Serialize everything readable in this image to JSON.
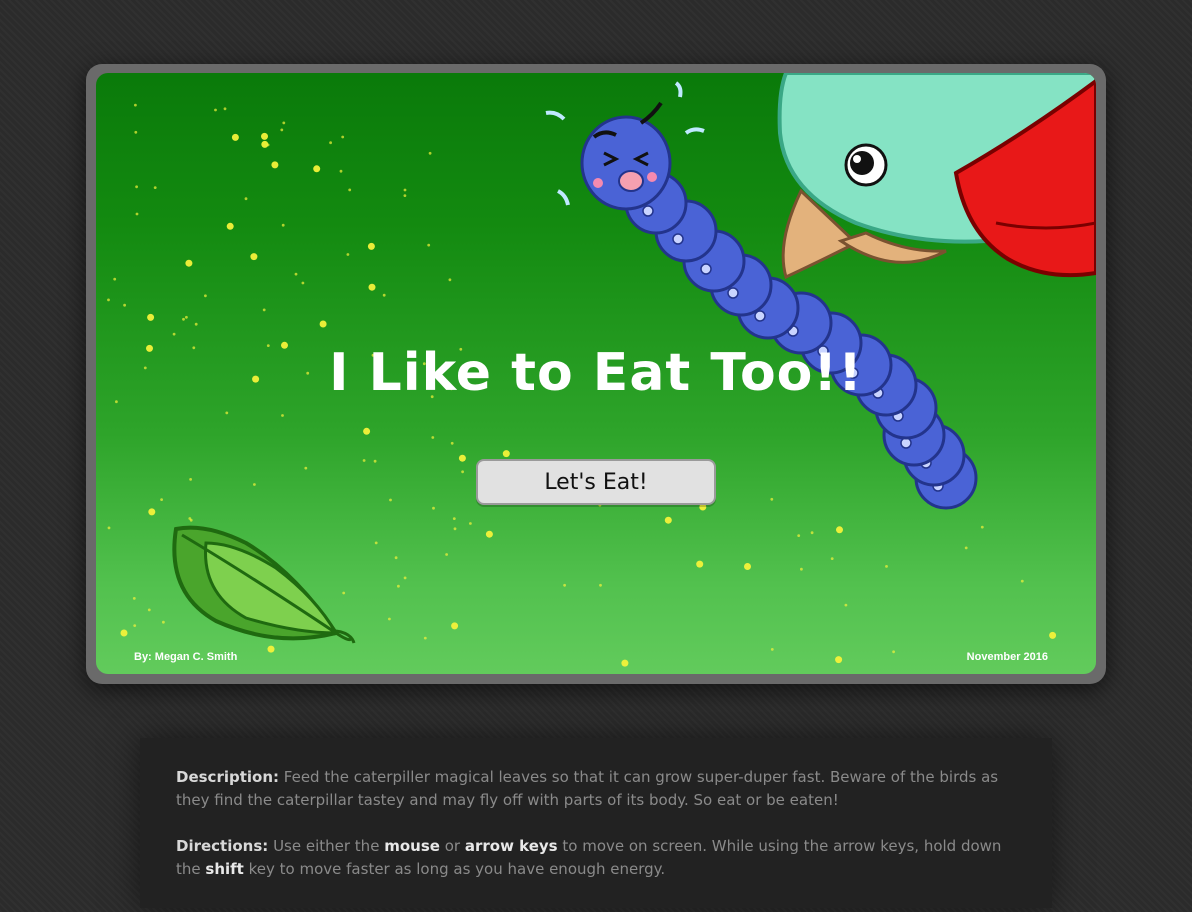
{
  "game": {
    "title": "I Like to Eat Too!!",
    "start_button": "Let's Eat!",
    "author": "By: Megan C. Smith",
    "date": "November 2016"
  },
  "info": {
    "description_label": "Description:",
    "description_text": "Feed the caterpiller magical leaves so that it can grow super-duper fast. Beware of the birds as they find the caterpillar tastey and may fly off with parts of its body. So eat or be eaten!",
    "directions_label": "Directions:",
    "directions_part1": "Use either the",
    "directions_kw_mouse": "mouse",
    "directions_or": "or",
    "directions_kw_arrows": "arrow keys",
    "directions_part2": "to move on screen. While using the arrow keys, hold down the",
    "directions_kw_shift": "shift",
    "directions_part3": "key to move faster as long as you have enough energy."
  },
  "colors": {
    "caterpillar": "#4a63d6",
    "bird_body": "#85e3c4",
    "bird_wing": "#e81818",
    "beak": "#e3b27c",
    "leaf": "#5cb83a",
    "firefly": "#f4f23a"
  },
  "icons": [
    "caterpillar-sprite",
    "bird-sprite",
    "leaf-sprite",
    "firefly-particles"
  ]
}
